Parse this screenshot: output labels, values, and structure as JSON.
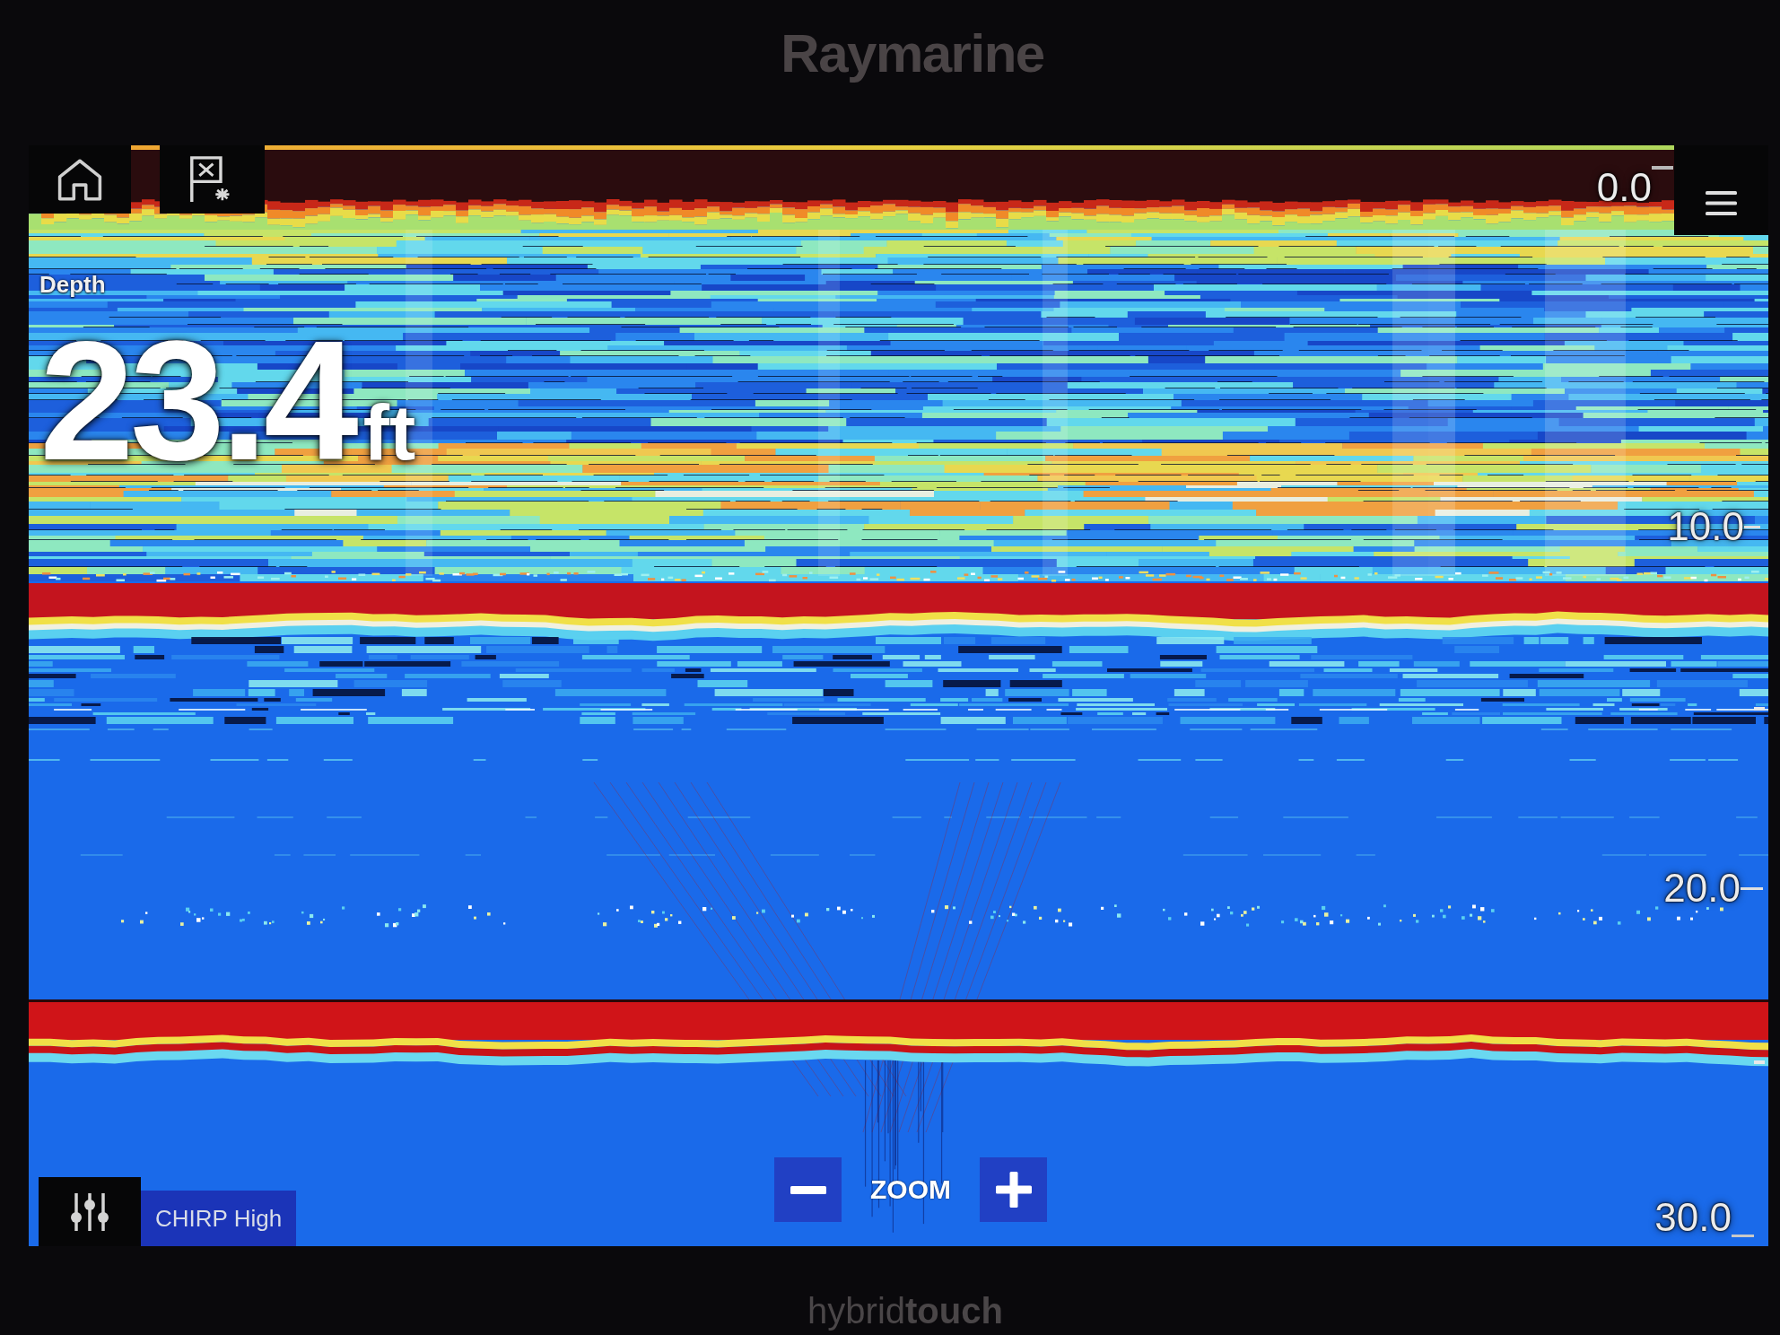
{
  "bezel": {
    "brand": "Raymarine",
    "model": "hybrid**touch**"
  },
  "depth": {
    "label": "Depth",
    "value": "23.4",
    "unit": "ft"
  },
  "depth_scale": [
    "0.0",
    "10.0",
    "20.0",
    "30.0"
  ],
  "channel": "CHIRP High",
  "zoom": {
    "label": "ZOOM"
  }
}
